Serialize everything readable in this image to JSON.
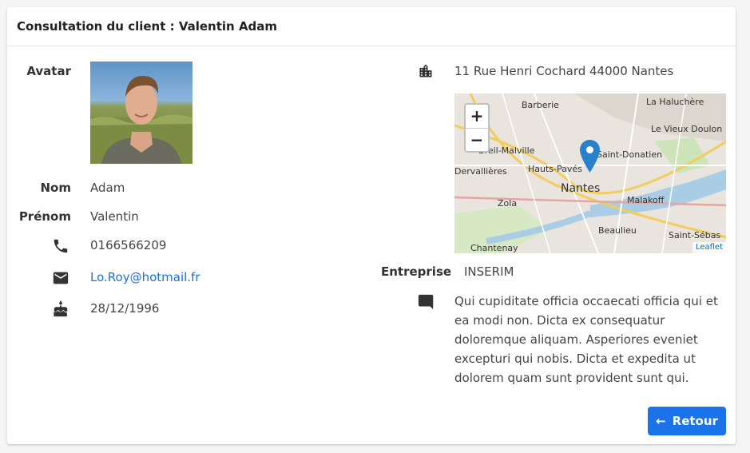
{
  "header": {
    "title": "Consultation du client : Valentin Adam"
  },
  "labels": {
    "avatar": "Avatar",
    "nom": "Nom",
    "prenom": "Prénom",
    "entreprise": "Entreprise"
  },
  "client": {
    "nom": "Adam",
    "prenom": "Valentin",
    "phone": "0166566209",
    "email": "Lo.Roy@hotmail.fr",
    "birthdate": "28/12/1996",
    "address": "11 Rue Henri Cochard 44000 Nantes",
    "entreprise": "INSERIM",
    "comment": "Qui cupiditate officia occaecati officia qui et ea modi non. Dicta ex consequatur doloremque aliquam. Asperiores eveniet excepturi qui nobis. Dicta et expedita ut dolorem quam sunt provident sunt qui."
  },
  "map": {
    "zoom_in": "+",
    "zoom_out": "−",
    "attribution": "Leaflet",
    "places": [
      "La Haluchère",
      "Barberie",
      "Le Vieux Doulon",
      "Breil-Malville",
      "Saint-Donatien",
      "Dervallières",
      "Hauts-Pavés",
      "Nantes",
      "Zola",
      "Malakoff",
      "Beaulieu",
      "Chantenay",
      "Saint-Sébas"
    ]
  },
  "actions": {
    "back_label": "Retour"
  },
  "colors": {
    "accent": "#1a73e8",
    "link": "#1e6fd9",
    "marker": "#2a81cb"
  }
}
